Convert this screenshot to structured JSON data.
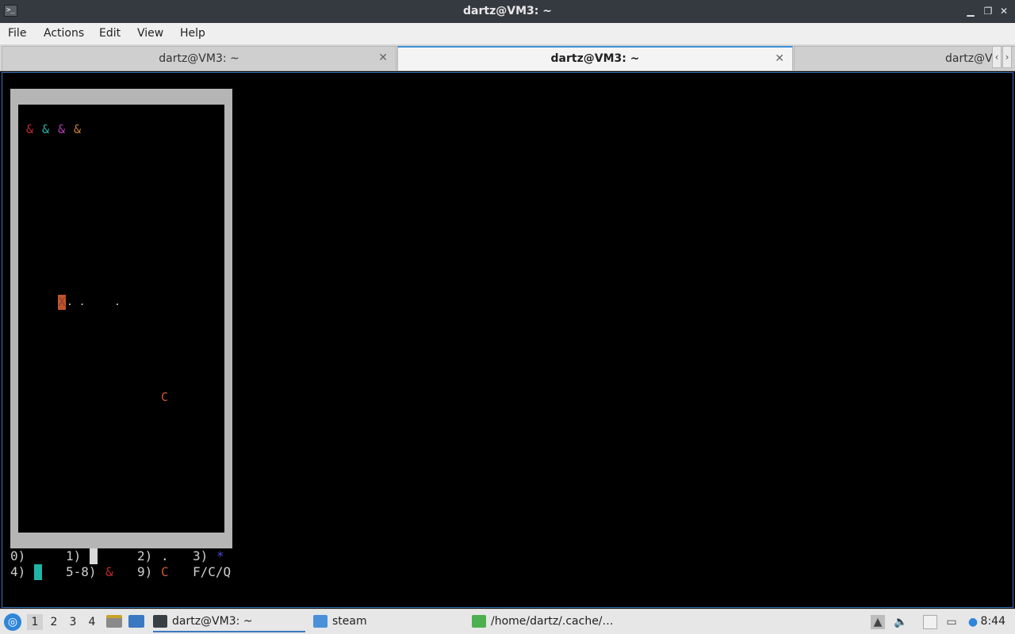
{
  "window": {
    "title": "dartz@VM3: ~",
    "minimize_glyph": "▁",
    "restore_glyph": "❐",
    "close_glyph": "✕"
  },
  "menu": [
    "File",
    "Actions",
    "Edit",
    "View",
    "Help"
  ],
  "tabs": [
    {
      "label": "dartz@VM3: ~",
      "active": false
    },
    {
      "label": "dartz@VM3: ~",
      "active": true
    },
    {
      "label": "dartz@V",
      "active": false
    }
  ],
  "tab_close_glyph": "✕",
  "tab_scroll": {
    "left": "‹",
    "right": "›"
  },
  "game": {
    "players": [
      {
        "glyph": "&",
        "color": "#c0282d"
      },
      {
        "glyph": "&",
        "color": "#1fb5a5"
      },
      {
        "glyph": "&",
        "color": "#b83ab8"
      },
      {
        "glyph": "&",
        "color": "#c8812f"
      }
    ],
    "cursor_glyph": "X",
    "trail": ". .",
    "dot": ".",
    "c_glyph": "C",
    "c_color": "#c15a2f",
    "legend": {
      "row1": {
        "k0": "0)",
        "k1": "1)",
        "k2": "2)",
        "v2": ".",
        "k3": "3)",
        "v3": "*"
      },
      "row2": {
        "k4": "4)",
        "k58": "5-8)",
        "v58": "&",
        "k9": "9)",
        "v9": "C",
        "keys": "F/C/Q"
      }
    },
    "colors": {
      "wall": "#d8d8d8",
      "teal": "#1fb5a5",
      "star": "#4a4ad8",
      "amp": "#c0282d"
    }
  },
  "taskbar": {
    "start_glyph": "◎",
    "workspaces": [
      "1",
      "2",
      "3",
      "4"
    ],
    "active_workspace": 0,
    "tasks": [
      {
        "label": "dartz@VM3: ~",
        "icon": "terminal-icon"
      },
      {
        "label": "steam",
        "icon": "folder-icon"
      },
      {
        "label": "/home/dartz/.cache/…",
        "icon": "archive-icon"
      }
    ],
    "clock": "8:44"
  }
}
